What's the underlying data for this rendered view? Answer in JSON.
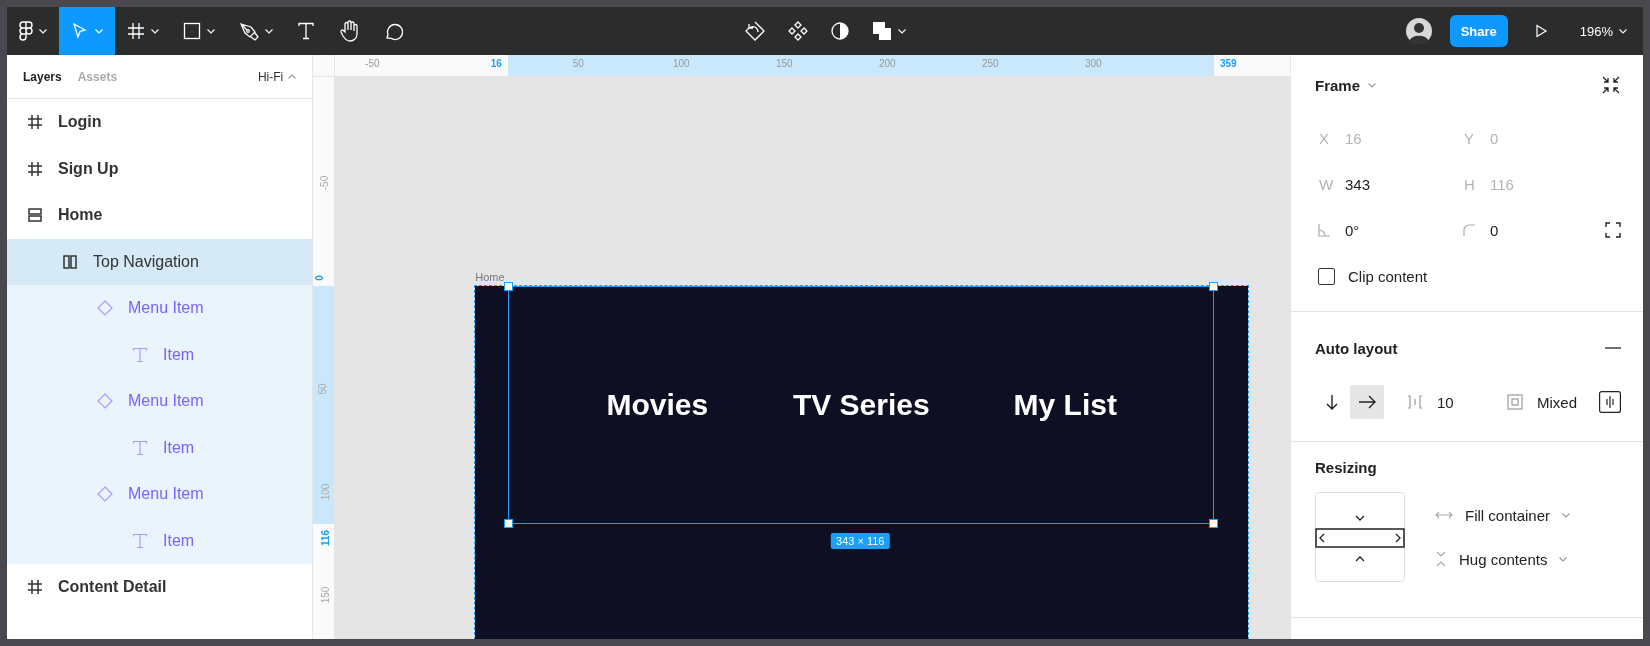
{
  "toolbar": {
    "tools": [
      {
        "kind": "main-menu",
        "selected": false
      },
      {
        "kind": "move",
        "selected": true
      },
      {
        "kind": "frame",
        "selected": false
      },
      {
        "kind": "shape",
        "selected": false
      },
      {
        "kind": "pen",
        "selected": false
      },
      {
        "kind": "text",
        "selected": false
      },
      {
        "kind": "hand",
        "selected": false
      },
      {
        "kind": "comment",
        "selected": false
      }
    ],
    "actions": [
      {
        "kind": "detach"
      },
      {
        "kind": "component"
      },
      {
        "kind": "mask"
      },
      {
        "kind": "boolean"
      }
    ],
    "share": "Share",
    "zoom": "196%"
  },
  "layers_panel": {
    "tabs": [
      {
        "label": "Layers",
        "selected": true
      },
      {
        "label": "Assets",
        "selected": false
      }
    ],
    "page": "Hi-Fi",
    "layers": [
      {
        "name": "Login",
        "kind": "frame",
        "selected": false
      },
      {
        "name": "Sign Up",
        "kind": "frame",
        "selected": false
      },
      {
        "name": "Home",
        "kind": "stack-vertical",
        "selected": false,
        "children": [
          {
            "name": "Top Navigation",
            "kind": "stack-horizontal",
            "selected": true,
            "children": [
              {
                "name": "Menu Item",
                "kind": "instance",
                "selected": false,
                "children": [
                  {
                    "name": "Item",
                    "kind": "text",
                    "selected": false
                  }
                ]
              },
              {
                "name": "Menu Item",
                "kind": "instance",
                "selected": false,
                "children": [
                  {
                    "name": "Item",
                    "kind": "text",
                    "selected": false
                  }
                ]
              },
              {
                "name": "Menu Item",
                "kind": "instance",
                "selected": false,
                "children": [
                  {
                    "name": "Item",
                    "kind": "text",
                    "selected": false
                  }
                ]
              }
            ]
          }
        ]
      },
      {
        "name": "Content Detail",
        "kind": "frame",
        "selected": false
      }
    ]
  },
  "rulers": {
    "top": [
      {
        "label": "-50",
        "selected": false
      },
      {
        "label": "16",
        "selected": true
      },
      {
        "label": "50",
        "selected": false
      },
      {
        "label": "100",
        "selected": false
      },
      {
        "label": "150",
        "selected": false
      },
      {
        "label": "200",
        "selected": false
      },
      {
        "label": "250",
        "selected": false
      },
      {
        "label": "300",
        "selected": false
      },
      {
        "label": "359",
        "selected": true
      }
    ],
    "left": [
      {
        "label": "-50",
        "selected": false
      },
      {
        "label": "0",
        "selected": true
      },
      {
        "label": "50",
        "selected": false
      },
      {
        "label": "100",
        "selected": false
      },
      {
        "label": "116",
        "selected": true
      },
      {
        "label": "150",
        "selected": false
      }
    ]
  },
  "canvas": {
    "frame_label": "Home",
    "nav_items": [
      "Movies",
      "TV Series",
      "My List"
    ],
    "size_badge": "343 × 116"
  },
  "design_panel": {
    "frame": {
      "title": "Frame",
      "fields": [
        {
          "kind": "letter",
          "label": "X",
          "value": "16",
          "disabled": true
        },
        {
          "kind": "letter",
          "label": "Y",
          "value": "0",
          "disabled": true
        },
        {
          "kind": "letter",
          "label": "W",
          "value": "343",
          "disabled": false
        },
        {
          "kind": "letter",
          "label": "H",
          "value": "116",
          "disabled": true
        },
        {
          "kind": "rotation",
          "value": "0°",
          "disabled": false
        },
        {
          "kind": "radius",
          "value": "0",
          "disabled": false
        }
      ],
      "clip_content": {
        "label": "Clip content",
        "checked": false
      }
    },
    "auto_layout": {
      "title": "Auto layout",
      "directions": [
        {
          "kind": "vertical",
          "selected": false
        },
        {
          "kind": "horizontal",
          "selected": true
        }
      ],
      "spacing": "10",
      "padding": "Mixed"
    },
    "resizing": {
      "title": "Resizing",
      "horizontal": "Fill container",
      "vertical": "Hug contents"
    }
  }
}
